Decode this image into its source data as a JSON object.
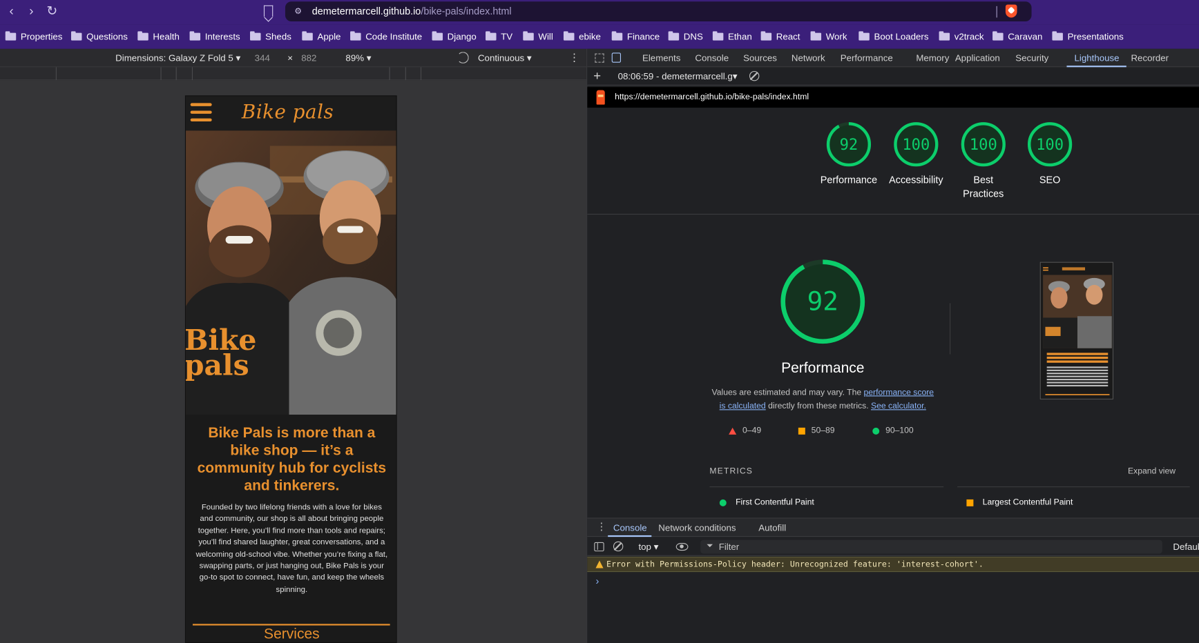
{
  "browser": {
    "back_label": "‹",
    "forward_label": "›",
    "reload_label": "↻",
    "url_host": "demetermarcell.github.io",
    "url_path": "/bike-pals/index.html"
  },
  "bookmarks": [
    "Properties",
    "Questions",
    "Health",
    "Interests",
    "Sheds",
    "Apple",
    "Code Institute",
    "Django",
    "TV",
    "Will",
    "ebike",
    "Finance",
    "DNS",
    "Ethan",
    "React",
    "Work",
    "Boot Loaders",
    "v2track",
    "Caravan",
    "Presentations"
  ],
  "device_toolbar": {
    "dimensions": "Dimensions: Galaxy Z Fold 5",
    "width": "344",
    "times": "×",
    "height": "882",
    "zoom": "89%",
    "throttle": "Continuous"
  },
  "page": {
    "logo": "Bike pals",
    "hero_text_line1": "Bike",
    "hero_text_line2": "pals",
    "tagline": "Bike Pals is more than a bike shop — it’s a community hub for cyclists and tinkerers.",
    "blurb": "Founded by two lifelong friends with a love for bikes and community, our shop is all about bringing people together. Here, you’ll find more than tools and repairs; you’ll find shared laughter, great conversations, and a welcoming old-school vibe. Whether you’re fixing a flat, swapping parts, or just hanging out, Bike Pals is your go-to spot to connect, have fun, and keep the wheels spinning.",
    "services_title": "Services"
  },
  "devtools": {
    "tabs": [
      "Elements",
      "Console",
      "Sources",
      "Network",
      "Performance",
      "Memory",
      "Application",
      "Security",
      "Lighthouse",
      "Recorder"
    ],
    "active_tab": "Lighthouse",
    "report_selector": "08:06:59 - demetermarcell.g",
    "report_url": "https://demetermarcell.github.io/bike-pals/index.html",
    "scores": [
      {
        "label": "Performance",
        "value": "92",
        "fraction": 0.92
      },
      {
        "label": "Accessibility",
        "value": "100",
        "fraction": 1.0
      },
      {
        "label": "Best Practices",
        "value": "100",
        "fraction": 1.0
      },
      {
        "label": "SEO",
        "value": "100",
        "fraction": 1.0
      }
    ],
    "main_score": {
      "value": "92",
      "fraction": 0.92,
      "title": "Performance"
    },
    "note_prefix": "Values are estimated and may vary. The",
    "note_link1": "performance score is calculated",
    "note_mid": "directly from these metrics.",
    "note_link2": "See calculator.",
    "legend": {
      "red": "0–49",
      "orange": "50–89",
      "green": "90–100"
    },
    "metrics_heading": "METRICS",
    "expand_view": "Expand view",
    "metric_fcp": "First Contentful Paint",
    "metric_lcp": "Largest Contentful Paint",
    "colors": {
      "pass": "#0cce6b",
      "average": "#ffa400",
      "fail": "#ff4e42",
      "accent": "#a8c7fa"
    }
  },
  "drawer": {
    "tabs": [
      "Console",
      "Network conditions",
      "Autofill"
    ],
    "active_tab": "Console",
    "context": "top ▾",
    "filter_placeholder": "Filter",
    "levels": "Default levels ▾",
    "error_message": "Error with Permissions-Policy header: Unrecognized feature: 'interest-cohort'.",
    "prompt": "›"
  }
}
